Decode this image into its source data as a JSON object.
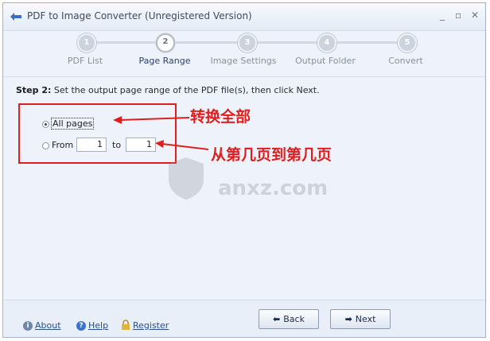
{
  "window": {
    "title": "PDF to Image Converter (Unregistered Version)",
    "controls": {
      "minimize": "_",
      "maximize": "▫",
      "close": "✕"
    }
  },
  "steps": [
    {
      "number": "1",
      "label": "PDF List"
    },
    {
      "number": "2",
      "label": "Page Range"
    },
    {
      "number": "3",
      "label": "Image Settings"
    },
    {
      "number": "4",
      "label": "Output Folder"
    },
    {
      "number": "5",
      "label": "Convert"
    }
  ],
  "active_step": 2,
  "instruction": {
    "step": "Step 2:",
    "text": "Set the output page range of the PDF file(s), then click Next."
  },
  "range": {
    "all_pages_label": "All pages",
    "from_label": "From",
    "from_value": "1",
    "to_label": "to",
    "to_value": "1",
    "selected": "all_pages"
  },
  "annotations": {
    "all_pages_note": "转换全部",
    "range_note": "从第几页到第几页",
    "color": "#e01e1e"
  },
  "watermark": {
    "text": "anxz.com"
  },
  "footer": {
    "about": "About",
    "help": "Help",
    "register": "Register",
    "back": "Back",
    "next": "Next"
  }
}
